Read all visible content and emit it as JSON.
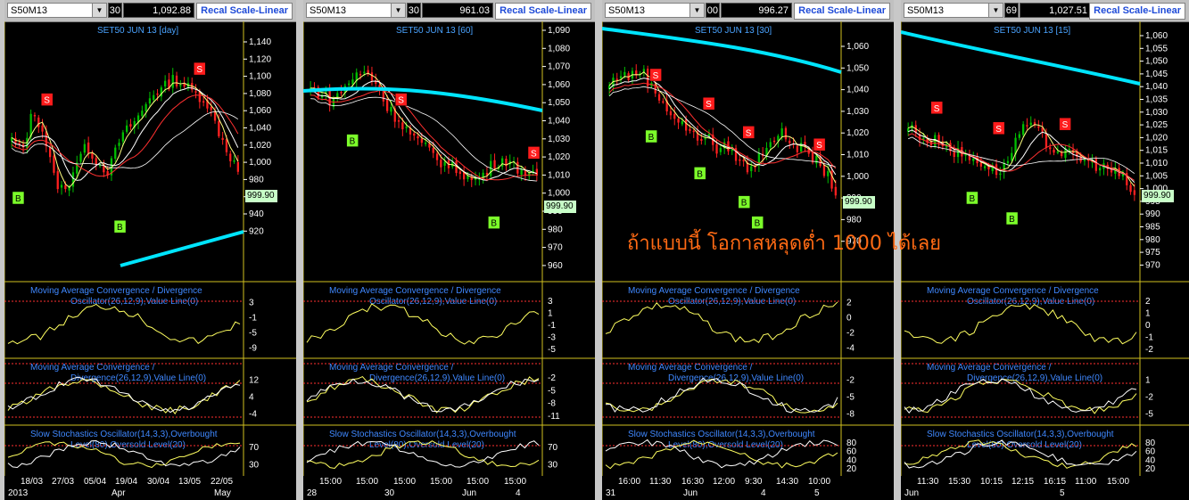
{
  "panels": [
    {
      "symbol": "S50M13",
      "partial": "30",
      "price": "1,092.88",
      "recal": "Recal Scale-Linear",
      "title": "SET50 JUN 13  [day]",
      "yticks": [
        "1,140",
        "1,120",
        "1,100",
        "1,080",
        "1,060",
        "1,040",
        "1,020",
        "1,000",
        "980",
        "960",
        "940",
        "920"
      ],
      "last_price": "999.90",
      "macd1_ticks": [
        "3",
        "-1",
        "-5",
        "-9"
      ],
      "macd2_ticks": [
        "12",
        "4",
        "-4"
      ],
      "stoch_ticks": [
        "70",
        "30"
      ],
      "x1": [
        "18/03",
        "27/03",
        "05/04",
        "19/04",
        "30/04",
        "13/05",
        "22/05"
      ],
      "x2": [
        "2013",
        "Apr",
        "May"
      ]
    },
    {
      "symbol": "S50M13",
      "partial": "30",
      "price": "961.03",
      "recal": "Recal Scale-Linear",
      "title": "SET50 JUN 13  [60]",
      "yticks": [
        "1,090",
        "1,080",
        "1,070",
        "1,060",
        "1,050",
        "1,040",
        "1,030",
        "1,020",
        "1,010",
        "1,000",
        "990",
        "980",
        "970",
        "960"
      ],
      "last_price": "999.90",
      "macd1_ticks": [
        "3",
        "1",
        "-1",
        "-3",
        "-5"
      ],
      "macd2_ticks": [
        "-2",
        "-5",
        "-8",
        "-11"
      ],
      "stoch_ticks": [
        "70",
        "30"
      ],
      "x1": [
        "15:00",
        "15:00",
        "15:00",
        "15:00",
        "15:00",
        "15:00"
      ],
      "x2": [
        "28",
        "30",
        "Jun",
        "4"
      ]
    },
    {
      "symbol": "S50M13",
      "partial": "00",
      "price": "996.27",
      "recal": "Recal Scale-Linear",
      "title": "SET50 JUN 13  [30]",
      "yticks": [
        "1,060",
        "1,050",
        "1,040",
        "1,030",
        "1,020",
        "1,010",
        "1,000",
        "990",
        "980",
        "970"
      ],
      "last_price": "999.90",
      "macd1_ticks": [
        "2",
        "0",
        "-2",
        "-4"
      ],
      "macd2_ticks": [
        "-2",
        "-5",
        "-8"
      ],
      "stoch_ticks": [
        "80",
        "60",
        "40",
        "20"
      ],
      "x1": [
        "16:00",
        "11:30",
        "16:30",
        "12:00",
        "9:30",
        "14:30",
        "10:00"
      ],
      "x2": [
        "31",
        "Jun",
        "4",
        "5"
      ]
    },
    {
      "symbol": "S50M13",
      "partial": "69",
      "price": "1,027.51",
      "recal": "Recal Scale-Linear",
      "title": "SET50 JUN 13  [15]",
      "yticks": [
        "1,060",
        "1,055",
        "1,050",
        "1,045",
        "1,040",
        "1,035",
        "1,030",
        "1,025",
        "1,020",
        "1,015",
        "1,010",
        "1,005",
        "1,000",
        "995",
        "990",
        "985",
        "980",
        "975",
        "970"
      ],
      "last_price": "999.90",
      "macd1_ticks": [
        "2",
        "1",
        "0",
        "-1",
        "-2"
      ],
      "macd2_ticks": [
        "1",
        "-2",
        "-5"
      ],
      "stoch_ticks": [
        "80",
        "60",
        "40",
        "20"
      ],
      "x1": [
        "11:30",
        "15:30",
        "10:15",
        "12:15",
        "16:15",
        "11:00",
        "15:00"
      ],
      "x2": [
        "Jun",
        "5"
      ]
    }
  ],
  "indicators": {
    "macd_osc": "Moving Average Convergence / Divergence",
    "macd_osc2": "Oscillator(26,12,9),Value Line(0)",
    "macd": "Moving Average Convergence /",
    "macd2": "Divergence(26,12,9),Value Line(0)",
    "stoch": "Slow Stochastics Oscillator(14,3,3),Overbought",
    "stoch2": "Level(80),Oversold Level(20)"
  },
  "signals": {
    "buy": "B",
    "sell": "S"
  },
  "overlay_text": "ถ้าแบบนี้ โอกาสหลุดต่ำ 1000 ได้เลย",
  "colors": {
    "accent": "#00e5ff",
    "up": "#00c000",
    "down": "#ff2020",
    "buy_bg": "#7cff2a",
    "sell_bg": "#ff1c1c",
    "overlay": "#ff6a14"
  }
}
